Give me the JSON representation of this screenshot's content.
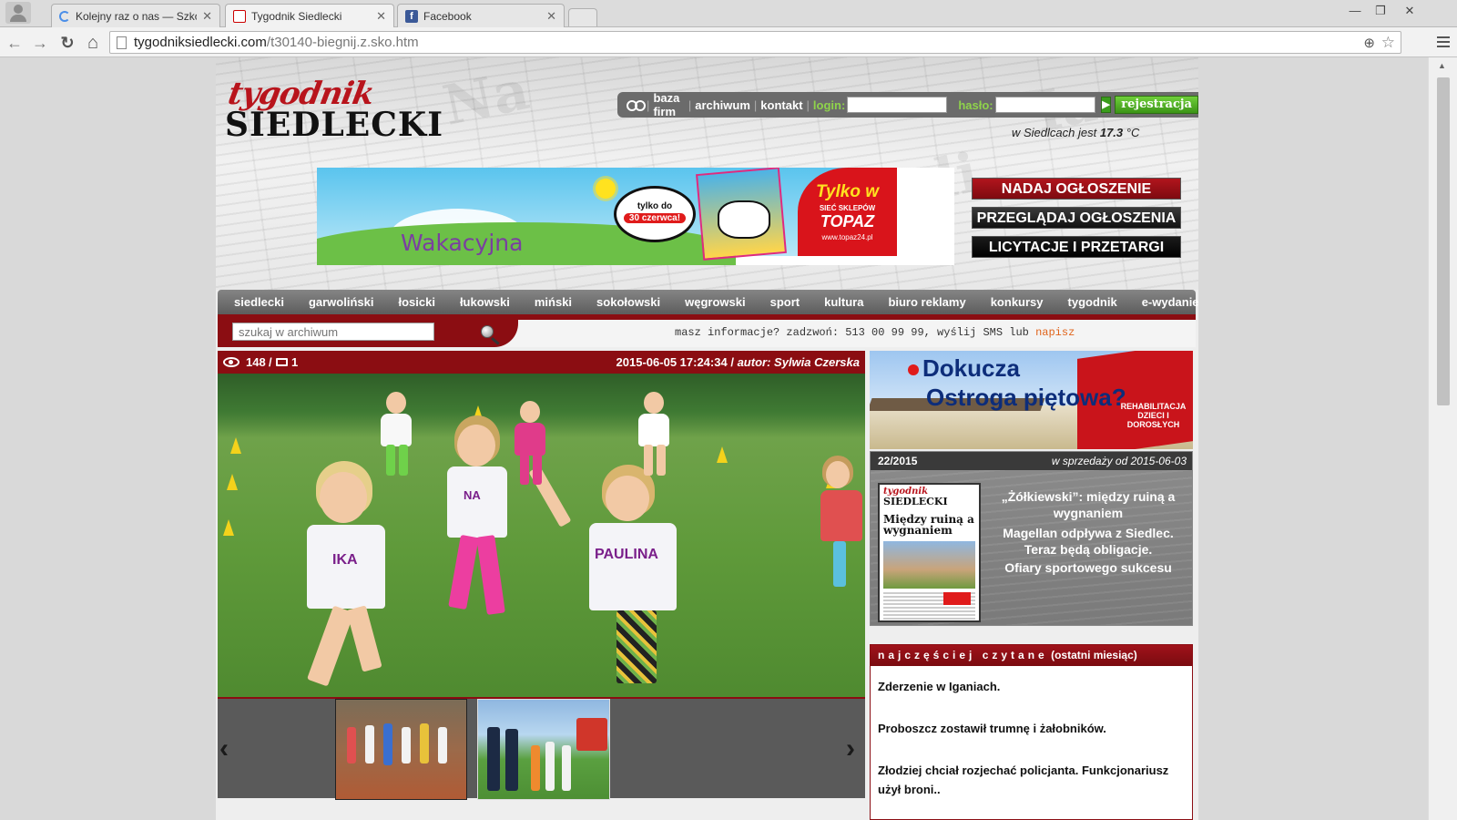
{
  "browser": {
    "tabs": [
      {
        "title": "Kolejny raz o nas — Szkoła",
        "active": false,
        "favicon": "loading-spinner"
      },
      {
        "title": "Tygodnik Siedlecki",
        "active": true,
        "favicon": "tygodnik-favicon"
      },
      {
        "title": "Facebook",
        "active": false,
        "favicon": "facebook-favicon"
      }
    ],
    "url_host": "tygodniksiedlecki.com",
    "url_path": "/t30140-biegnij.z.sko.htm",
    "window_controls": {
      "minimize": "—",
      "maximize": "❐",
      "close": "✕"
    },
    "nav_glyphs": {
      "back": "←",
      "forward": "→",
      "reload": "↻",
      "home": "⌂",
      "zoom": "⊕",
      "star": "☆"
    }
  },
  "site": {
    "logo_top": "tygodnik",
    "logo_bottom": "SIEDLECKI",
    "toplinks": {
      "baza_firm": "baza firm",
      "archiwum": "archiwum",
      "kontakt": "kontakt",
      "login_label": "login:",
      "haslo_label": "hasło:",
      "register": "rejestracja",
      "go_glyph": "▶",
      "separator": "|"
    },
    "weather": {
      "prefix": "w Siedlcach jest",
      "value": "17.3",
      "unit": "°C"
    },
    "banner": {
      "title": "Wakacyjna",
      "bubble_line1": "tylko do",
      "bubble_line2": "30 czerwca!",
      "right_line1": "Tylko w",
      "right_line2": "SIEĆ SKLEPÓW",
      "right_line3": "TOPAZ",
      "right_line4": "www.topaz24.pl"
    },
    "classifieds": {
      "nadaj": "NADAJ OGŁOSZENIE",
      "przegladaj": "PRZEGLĄDAJ OGŁOSZENIA",
      "licytacje": "LICYTACJE I PRZETARGI"
    },
    "nav": [
      "siedlecki",
      "garwoliński",
      "łosicki",
      "łukowski",
      "miński",
      "sokołowski",
      "węgrowski",
      "sport",
      "kultura",
      "biuro reklamy",
      "konkursy",
      "tygodnik",
      "e-wydanie"
    ],
    "search": {
      "placeholder": "szukaj w archiwum"
    },
    "infoline": {
      "text": "masz informacje? zadzwoń: 513 00 99 99, wyślij SMS lub",
      "link": "napisz"
    }
  },
  "article": {
    "views": "148",
    "separator": "/",
    "comments": "1",
    "datetime": "2015-06-05 17:24:34",
    "author_prefix": "autor:",
    "author": "Sylwia Czerska",
    "shirt_labels": [
      "IKA",
      "PAULINA",
      "NA"
    ],
    "gallery": {
      "prev": "‹",
      "next": "›"
    }
  },
  "sidebar": {
    "ad": {
      "line1": "Dokucza",
      "line2": "Ostroga piętowa?",
      "sign": "REHABILITACJA DZIECI I DOROSŁYCH"
    },
    "issue": {
      "number": "22/2015",
      "on_sale": "w sprzedaży od 2015-06-03",
      "cover_logo_top": "tygodnik",
      "cover_logo_bottom": "SIEDLECKI",
      "cover_headline": "Między ruiną a wygnaniem",
      "links": [
        "„Żółkiewski”: między ruiną a wygnaniem",
        "Magellan odpływa z Siedlec. Teraz będą obligacje.",
        "Ofiary sportowego sukcesu"
      ]
    },
    "popular": {
      "title": "najczęściej czytane",
      "subtitle": "(ostatni miesiąc)",
      "items": [
        "Zderzenie w Iganiach.",
        "Proboszcz zostawił trumnę i żałobników.",
        "Złodziej chciał rozjechać policjanta. Funkcjonariusz użył broni.."
      ]
    }
  },
  "colors": {
    "brand_red": "#8b0d12",
    "nav_gray": "#6b6b6b",
    "link_orange": "#e0641b",
    "login_green": "#8fd34b"
  }
}
